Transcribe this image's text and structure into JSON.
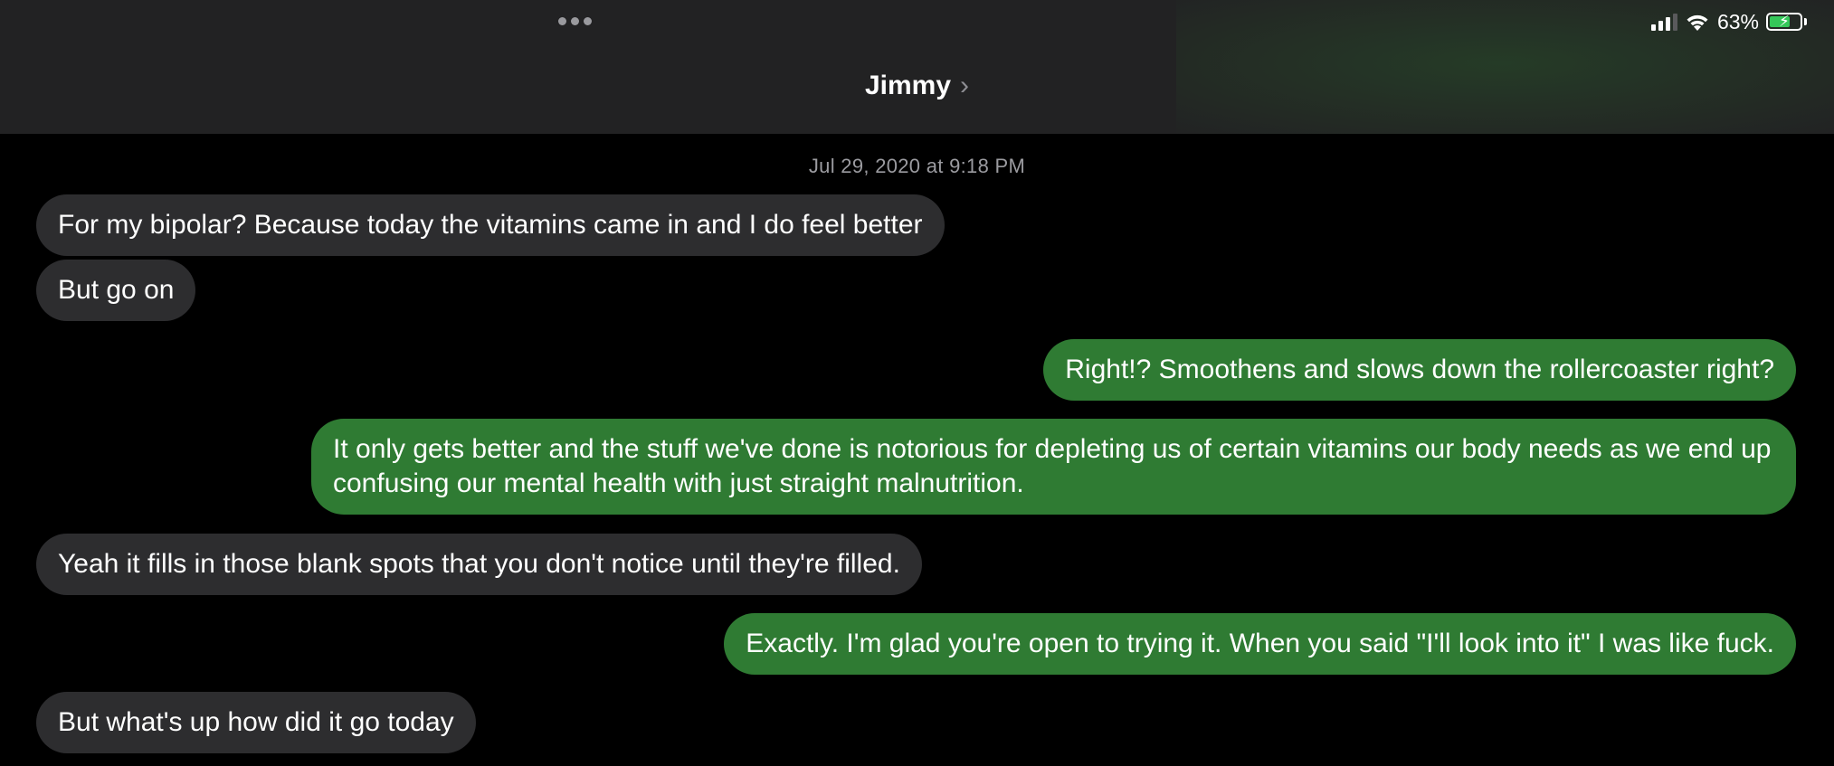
{
  "status_bar": {
    "battery_percent": "63%",
    "battery_level": 0.63,
    "signal_bars": 3,
    "icons": [
      "multitask-dots-icon",
      "cellular-signal-icon",
      "wifi-icon",
      "battery-charging-icon"
    ]
  },
  "header": {
    "contact_name": "Jimmy",
    "chevron": "›"
  },
  "conversation": {
    "timestamp": "Jul 29, 2020 at 9:18 PM",
    "messages": [
      {
        "from": "them",
        "text": "For my bipolar? Because today the vitamins came in and I do feel better"
      },
      {
        "from": "them",
        "text": "But go on"
      },
      {
        "from": "me",
        "text": "Right!? Smoothens and slows down the rollercoaster right?"
      },
      {
        "from": "me",
        "text": "It only gets better and the stuff we've done is notorious for depleting us of certain vitamins our body needs as we end up confusing our mental health with just straight malnutrition."
      },
      {
        "from": "them",
        "text": "Yeah it fills in those blank spots that you don't notice until they're filled."
      },
      {
        "from": "me",
        "text": "Exactly. I'm glad you're open to trying it. When you said \"I'll look into it\" I was like fuck."
      },
      {
        "from": "them",
        "text": "But what's up how did it go today"
      }
    ]
  },
  "colors": {
    "incoming_bubble": "#2d2d2f",
    "outgoing_bubble": "#2f7b33",
    "header_bg": "#222223",
    "background": "#000000"
  }
}
